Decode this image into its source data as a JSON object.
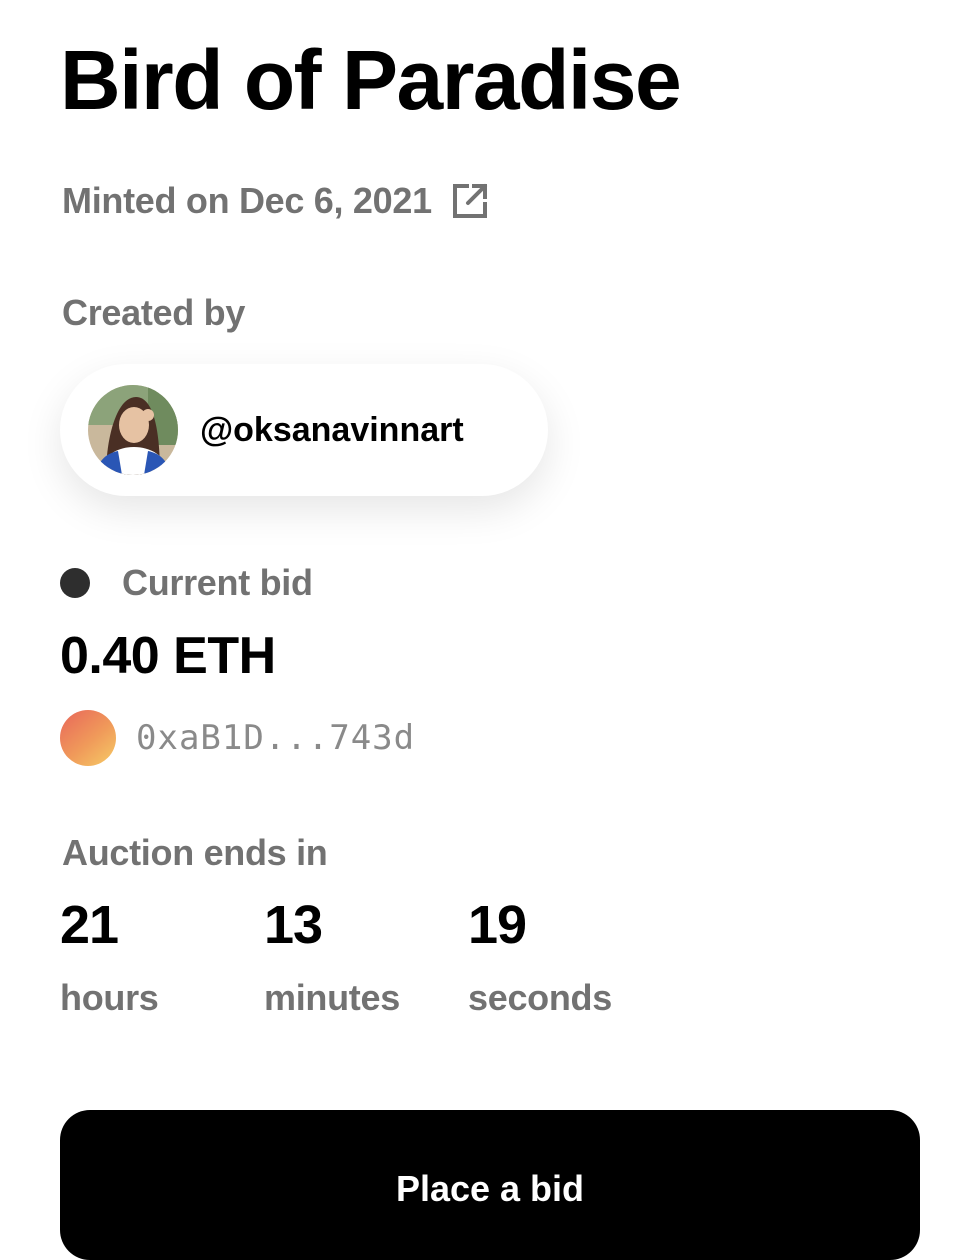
{
  "nft": {
    "title": "Bird of Paradise",
    "minted": "Minted on Dec 6, 2021",
    "external_link_icon": "external-link-icon"
  },
  "creator": {
    "label": "Created by",
    "handle": "@oksanavinnart"
  },
  "bid": {
    "label": "Current bid",
    "amount": "0.40 ETH",
    "bidder_address": "0xaB1D...743d"
  },
  "auction": {
    "label": "Auction ends in",
    "countdown": [
      {
        "value": "21",
        "unit": "hours"
      },
      {
        "value": "13",
        "unit": "minutes"
      },
      {
        "value": "19",
        "unit": "seconds"
      }
    ]
  },
  "actions": {
    "place_bid_label": "Place a bid"
  },
  "colors": {
    "text_primary": "#000000",
    "text_secondary": "#727272",
    "button_bg": "#000000",
    "button_text": "#ffffff",
    "status_dot": "#2e2e2e"
  }
}
